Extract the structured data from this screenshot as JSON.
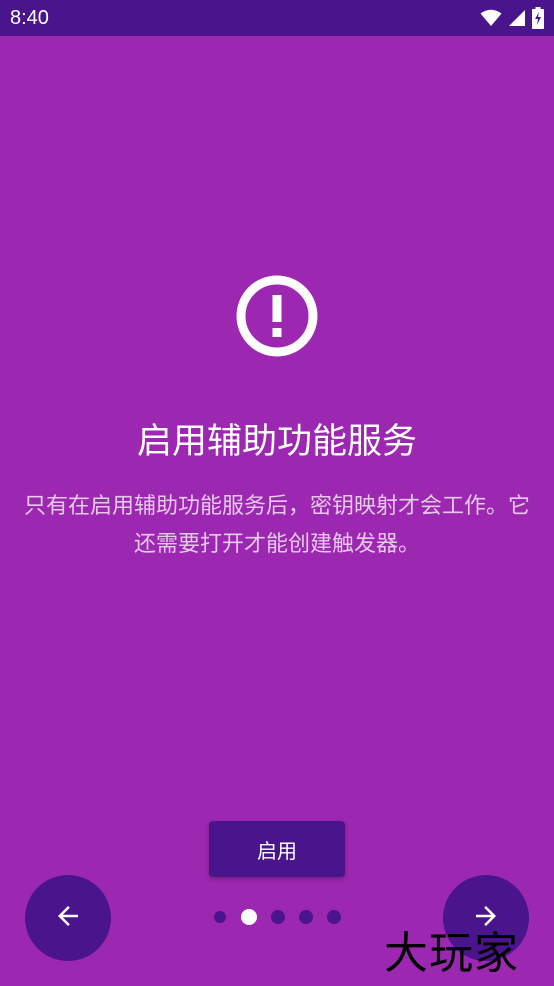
{
  "status_bar": {
    "time": "8:40",
    "icons": [
      "wifi-icon",
      "signal-icon",
      "battery-charging-icon"
    ],
    "background": "#4a148c"
  },
  "slide": {
    "icon": "alert-circle-icon",
    "title": "启用辅助功能服务",
    "description": "只有在启用辅助功能服务后，密钥映射才会工作。它还需要打开才能创建触发器。",
    "background": "#9c27b0"
  },
  "actions": {
    "enable_label": "启用"
  },
  "navigation": {
    "prev_icon": "arrow-left-icon",
    "next_icon": "arrow-right-icon",
    "page_count": 5,
    "current_page": 2
  },
  "watermark": {
    "text": "大玩家"
  }
}
